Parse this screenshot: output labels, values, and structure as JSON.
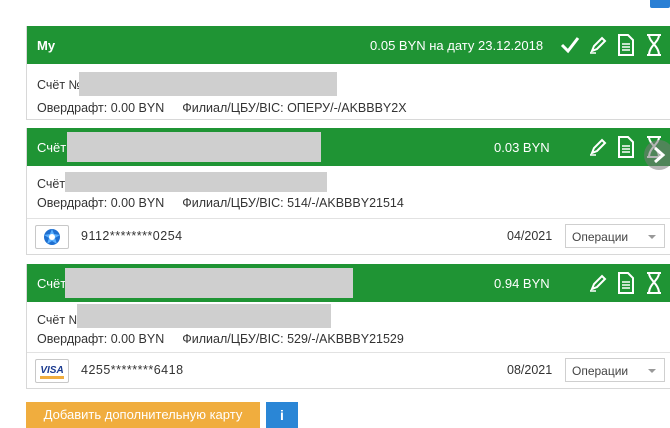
{
  "accounts": [
    {
      "title": "My",
      "amount": "0.05 BYN на дату 23.12.2018",
      "account_label": "Счёт №",
      "overdraft": "Овердрафт: 0.00 BYN",
      "branch": "Филиал/ЦБУ/BIC: ОПЕРУ/-/AKBBBY2X"
    },
    {
      "title": "Счёт",
      "amount": "0.03 BYN",
      "account_label": "Счёт",
      "overdraft": "Овердрафт: 0.00 BYN",
      "branch": "Филиал/ЦБУ/BIC: 514/-/AKBBBY21514",
      "card": {
        "icon": "gear-flower-card-icon",
        "number": "9112********0254",
        "expiry": "04/2021",
        "operations": "Операции"
      }
    },
    {
      "title": "Счёт",
      "amount": "0.94 BYN",
      "account_label": "Счёт №",
      "overdraft": "Овердрафт: 0.00 BYN",
      "branch": "Филиал/ЦБУ/BIC: 529/-/AKBBBY21529",
      "card": {
        "icon": "visa-logo",
        "logo_text": "VISA",
        "number": "4255********6418",
        "expiry": "08/2021",
        "operations": "Операции"
      }
    }
  ],
  "actions": {
    "add_card": "Добавить дополнительную карту",
    "info": "i"
  },
  "colors": {
    "header_green": "#1f9434",
    "add_button": "#f0ad3e",
    "info_button": "#2a86d6"
  }
}
